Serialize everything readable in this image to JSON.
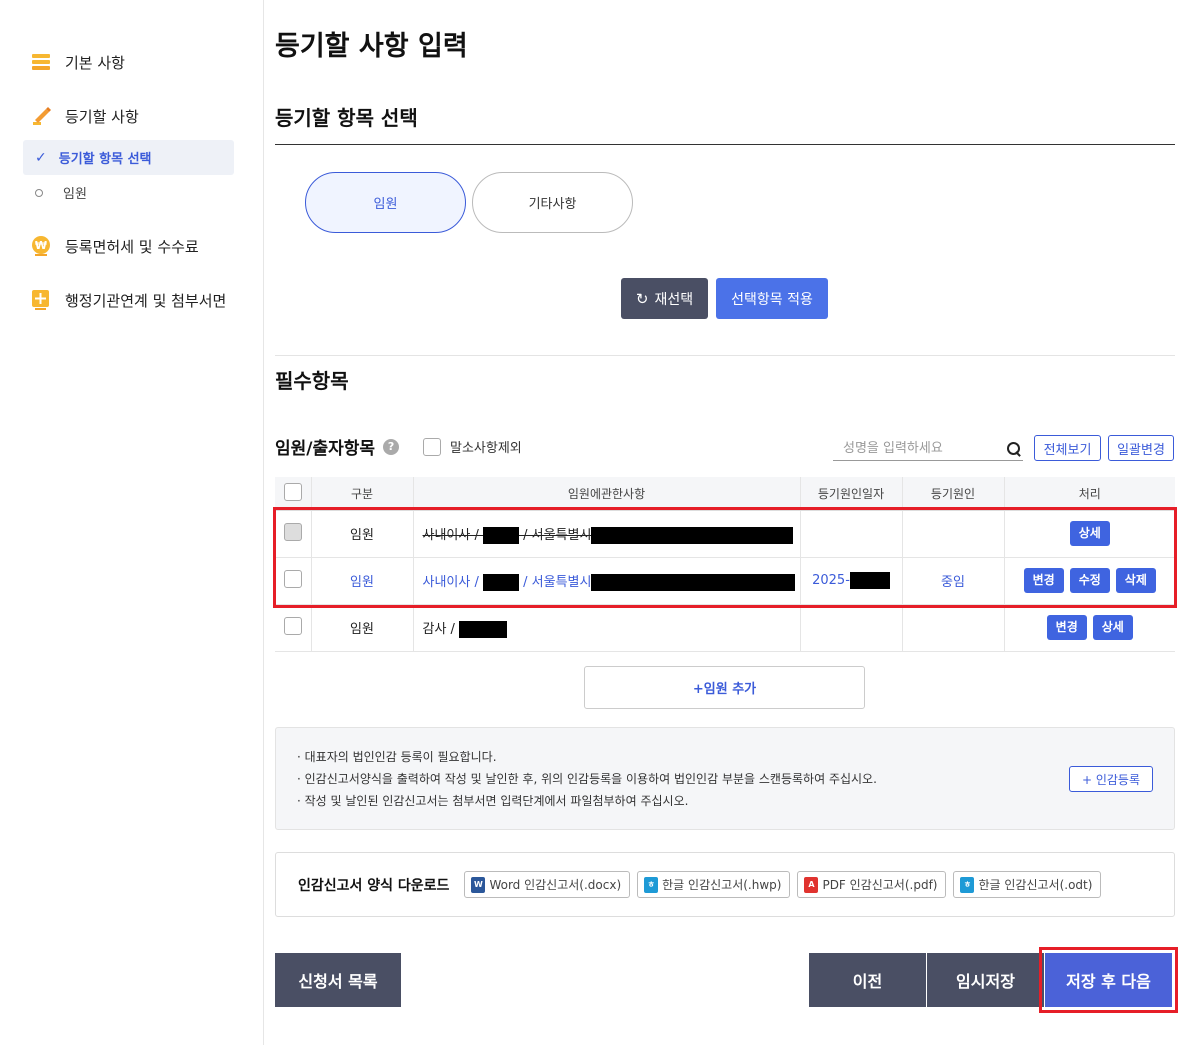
{
  "sidebar": {
    "items": [
      {
        "label": "기본 사항"
      },
      {
        "label": "등기할 사항"
      },
      {
        "label": "등록면허세 및 수수료"
      },
      {
        "label": "행정기관연계 및 첨부서면"
      }
    ],
    "sub_active": "등기할 항목 선택",
    "sub_item": "임원"
  },
  "page_title": "등기할 사항 입력",
  "section_title": "등기할 항목 선택",
  "tabs": [
    {
      "label": "임원"
    },
    {
      "label": "기타사항"
    }
  ],
  "buttons": {
    "reselect": "재선택",
    "apply": "선택항목 적용",
    "view_all": "전체보기",
    "bulk_change": "일괄변경",
    "add_officer": "+임원 추가",
    "seal_register": "+ 인감등록"
  },
  "required_title": "필수항목",
  "subsection": {
    "title": "임원/출자항목",
    "exclude_label": "말소사항제외"
  },
  "search": {
    "placeholder": "성명을 입력하세요"
  },
  "table": {
    "headers": [
      "구분",
      "임원에관한사항",
      "등기원인일자",
      "등기원인",
      "처리"
    ],
    "rows": [
      {
        "type": "임원",
        "detail_prefix": "사내이사 / ",
        "detail_mid": " / 서울특별시",
        "date": "",
        "cause": "",
        "actions": [
          "상세"
        ]
      },
      {
        "type": "임원",
        "detail_prefix": "사내이사 / ",
        "detail_mid": " / 서울특별시",
        "date": "2025-",
        "cause": "중임",
        "actions": [
          "변경",
          "수정",
          "삭제"
        ]
      },
      {
        "type": "임원",
        "detail_prefix": "감사 / ",
        "detail_mid": "",
        "date": "",
        "cause": "",
        "actions": [
          "변경",
          "상세"
        ]
      }
    ]
  },
  "notice": {
    "lines": [
      "· 대표자의 법인인감 등록이 필요합니다.",
      "· 인감신고서양식을 출력하여 작성 및 날인한 후, 위의 인감등록을 이용하여 법인인감 부분을 스캔등록하여 주십시오.",
      "· 작성 및 날인된 인감신고서는 첨부서면 입력단계에서 파일첨부하여 주십시오."
    ]
  },
  "download": {
    "label": "인감신고서 양식 다운로드",
    "files": [
      {
        "label": "Word 인감신고서(.docx)",
        "icon": "word-icon",
        "color": "#2b579a"
      },
      {
        "label": "한글 인감신고서(.hwp)",
        "icon": "hwp-icon",
        "color": "#1e9ad6"
      },
      {
        "label": "PDF 인감신고서(.pdf)",
        "icon": "pdf-icon",
        "color": "#e0332f"
      },
      {
        "label": "한글 인감신고서(.odt)",
        "icon": "odt-icon",
        "color": "#1e9ad6"
      }
    ]
  },
  "footer": {
    "list": "신청서 목록",
    "prev": "이전",
    "temp_save": "임시저장",
    "save_next": "저장 후 다음"
  }
}
